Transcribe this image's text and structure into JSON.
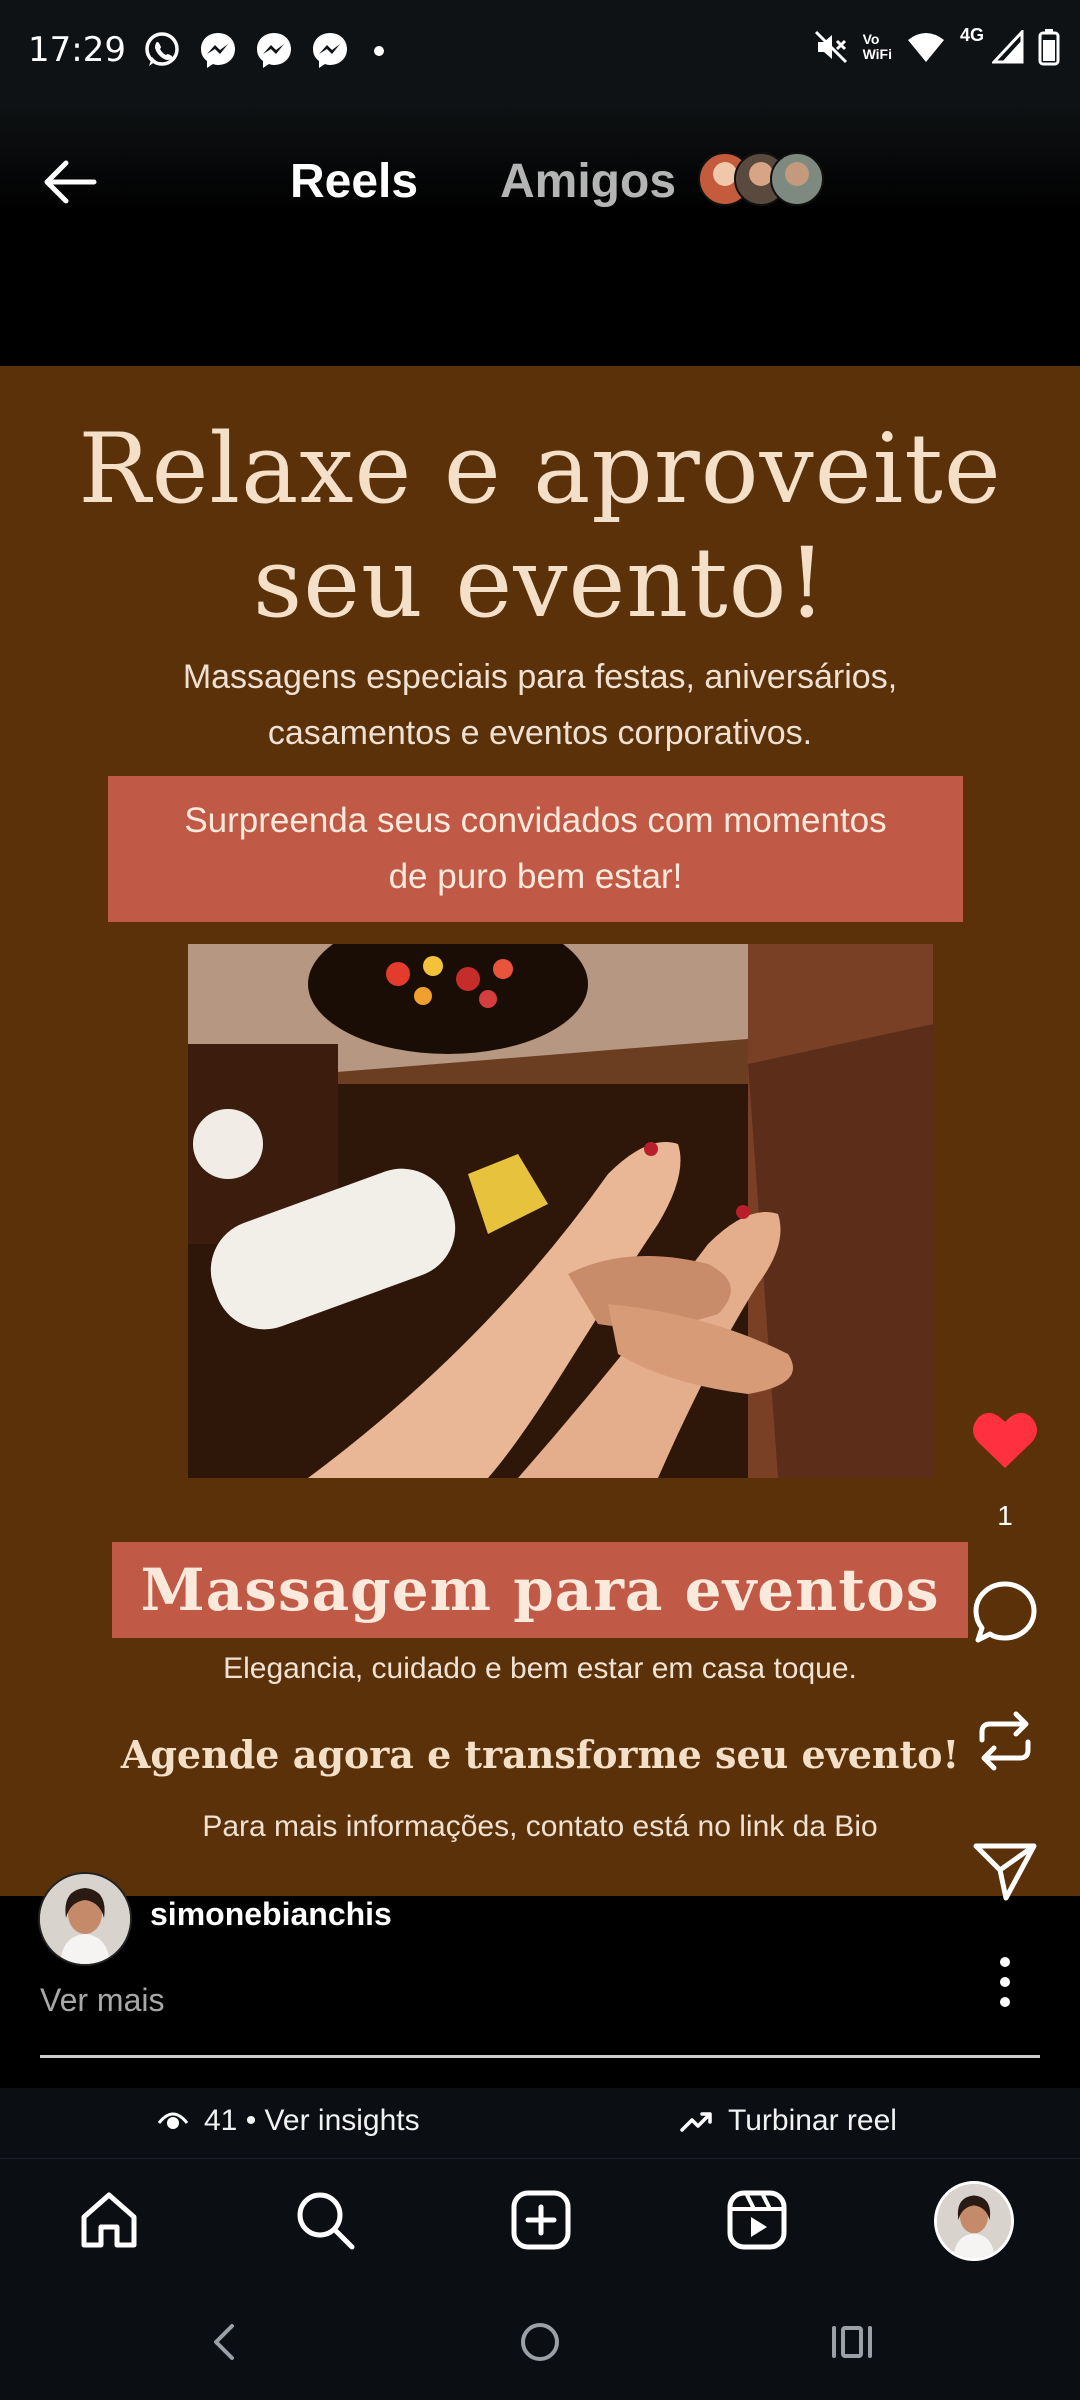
{
  "status_bar": {
    "time": "17:29",
    "notification_icons": [
      "whatsapp-icon",
      "messenger-icon",
      "messenger-icon",
      "messenger-icon"
    ],
    "volte_label": "Vo\nWiFi",
    "network_type": "4G"
  },
  "header": {
    "tabs": [
      {
        "label": "Reels",
        "active": true
      },
      {
        "label": "Amigos",
        "active": false
      }
    ]
  },
  "reel": {
    "title_line1": "Relaxe e aproveite",
    "title_line2": "seu evento!",
    "subtitle_line1": "Massagens especiais para festas, aniversários,",
    "subtitle_line2": "casamentos e eventos corporativos.",
    "banner_line1": "Surpreenda seus convidados com momentos",
    "banner_line2": "de puro bem estar!",
    "headline": "Massagem para eventos",
    "tagline": "Elegancia, cuidado e bem estar em casa toque.",
    "cta": "Agende agora e transforme seu evento!",
    "info": "Para mais informações, contato está no link da Bio",
    "colors": {
      "background": "#5a3108",
      "accent": "#c05a46",
      "text": "#f4dfc8"
    }
  },
  "actions": {
    "liked": true,
    "like_count": "1",
    "like_color": "#ff3040"
  },
  "caption": {
    "username": "simonebianchis",
    "see_more": "Ver mais"
  },
  "insights": {
    "views_label": "41 • Ver insights",
    "boost_label": "Turbinar reel"
  },
  "bottom_nav": {
    "items": [
      "home-icon",
      "search-icon",
      "create-icon",
      "reels-icon",
      "profile-avatar"
    ],
    "active": "reels-icon"
  }
}
